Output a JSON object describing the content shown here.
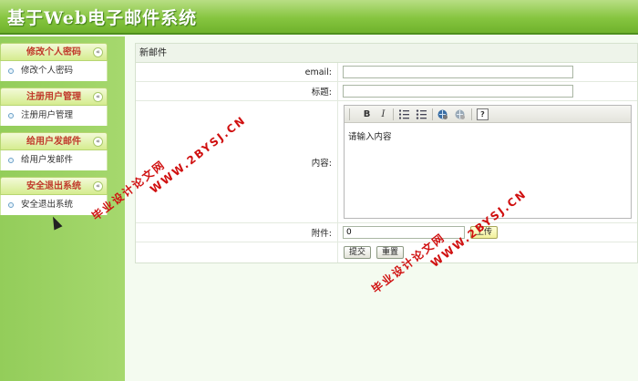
{
  "header": {
    "title": "基于Web电子邮件系统"
  },
  "sidebar": {
    "groups": [
      {
        "title": "修改个人密码",
        "items": [
          "修改个人密码"
        ]
      },
      {
        "title": "注册用户管理",
        "items": [
          "注册用户管理"
        ]
      },
      {
        "title": "给用户发邮件",
        "items": [
          "给用户发邮件"
        ]
      },
      {
        "title": "安全退出系统",
        "items": [
          "安全退出系统"
        ]
      }
    ],
    "collapse_glyph": "«",
    "bullet_icon": "circle-bullet-icon"
  },
  "form": {
    "panel_title": "新邮件",
    "email_label": "email:",
    "email_value": "",
    "subject_label": "标题:",
    "subject_value": "",
    "content_label": "内容:",
    "content_value": "请输入内容",
    "attachment_label": "附件:",
    "attachment_value": "0",
    "upload_label": "上传",
    "submit_label": "提交",
    "reset_label": "重置"
  },
  "editor_toolbar": {
    "bold": "B",
    "italic": "I",
    "icons": [
      "bold-icon",
      "italic-icon",
      "ordered-list-icon",
      "unordered-list-icon",
      "link-icon",
      "unlink-icon",
      "help-icon"
    ]
  },
  "watermarks": {
    "text_cn": "毕业设计论文网",
    "text_url": "WWW.2BYSJ.CN"
  },
  "colors": {
    "header_green": "#86c540",
    "sidebar_green": "#9ed266",
    "menu_title_red": "#c0392b",
    "watermark_red": "#d01010"
  }
}
